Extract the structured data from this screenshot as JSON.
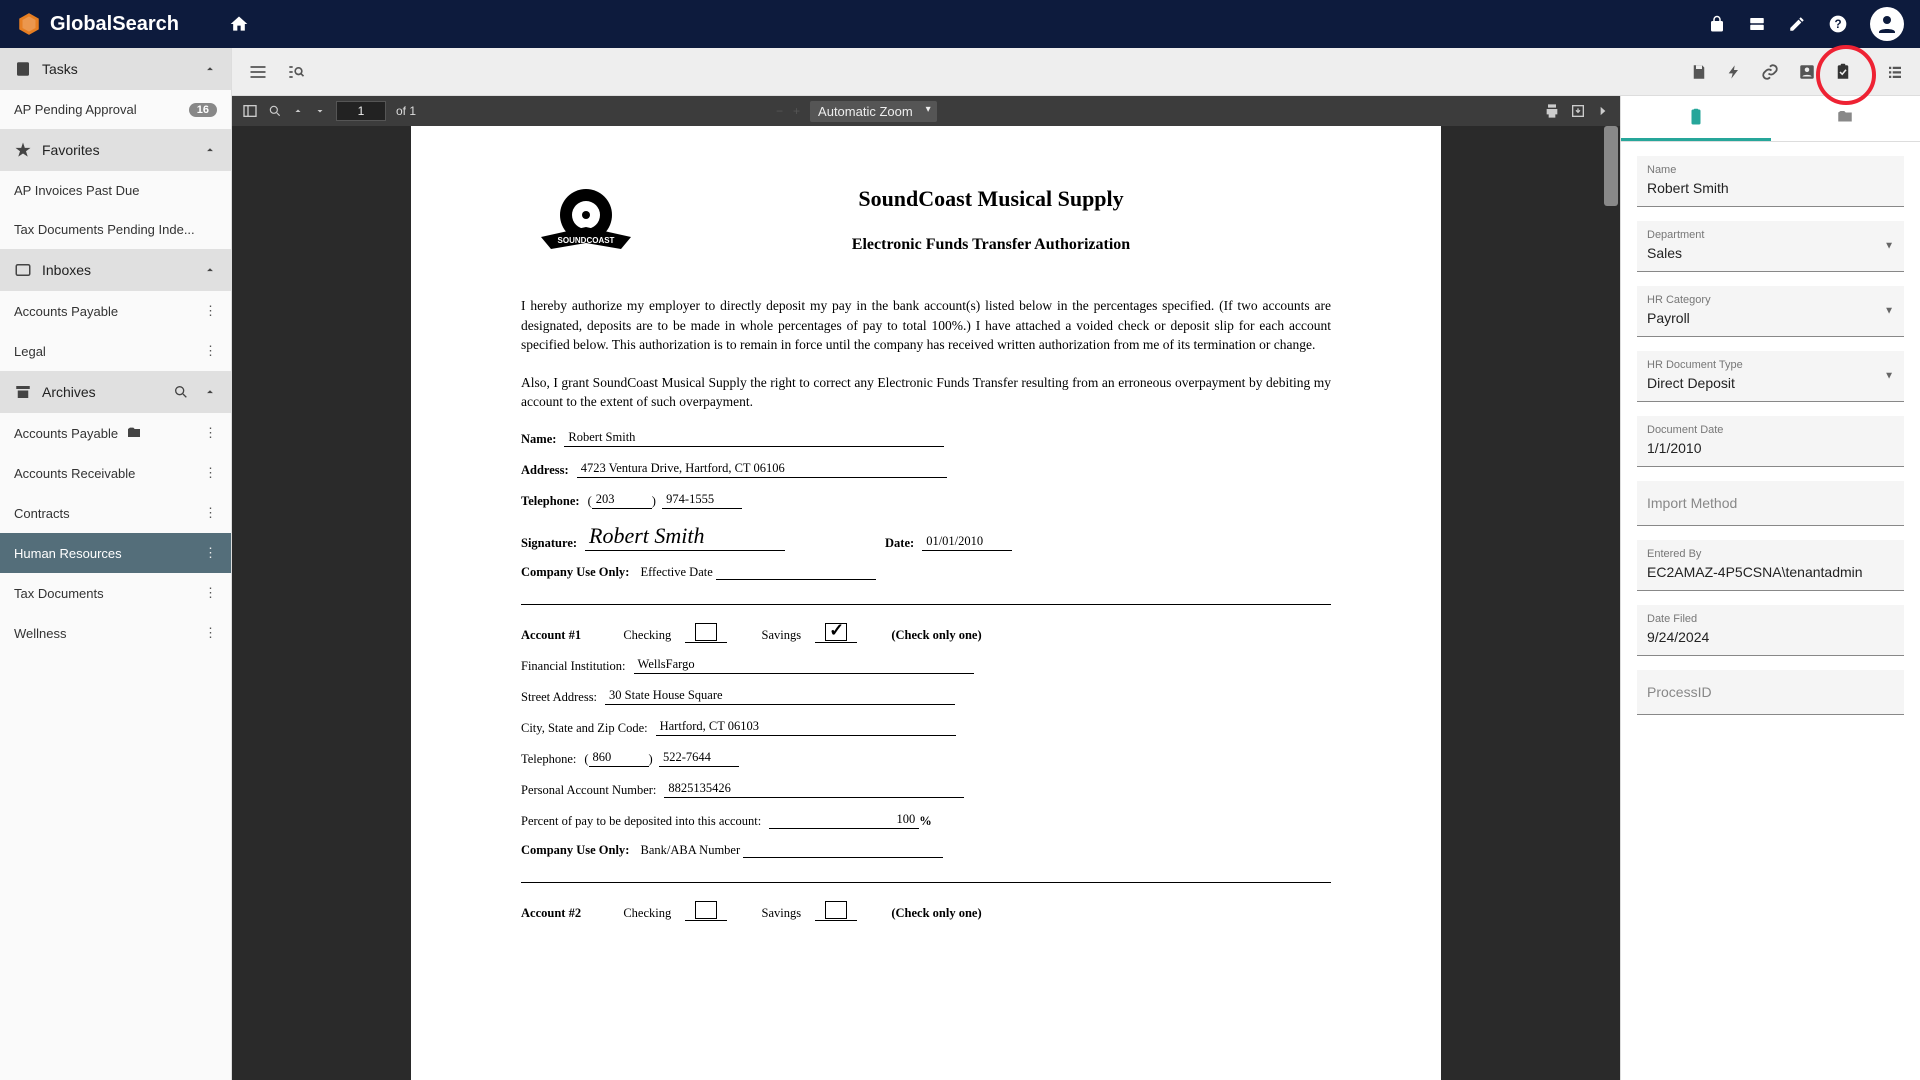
{
  "app": {
    "name": "GlobalSearch"
  },
  "sidebar": {
    "tasks": {
      "label": "Tasks",
      "items": [
        {
          "label": "AP Pending Approval",
          "badge": "16"
        }
      ]
    },
    "favorites": {
      "label": "Favorites",
      "items": [
        {
          "label": "AP Invoices Past Due"
        },
        {
          "label": "Tax Documents Pending Inde..."
        }
      ]
    },
    "inboxes": {
      "label": "Inboxes",
      "items": [
        {
          "label": "Accounts Payable"
        },
        {
          "label": "Legal"
        }
      ]
    },
    "archives": {
      "label": "Archives",
      "items": [
        {
          "label": "Accounts Payable",
          "folder": true
        },
        {
          "label": "Accounts Receivable"
        },
        {
          "label": "Contracts"
        },
        {
          "label": "Human Resources",
          "selected": true
        },
        {
          "label": "Tax Documents"
        },
        {
          "label": "Wellness"
        }
      ]
    }
  },
  "viewer": {
    "page_current": "1",
    "page_total": "of 1",
    "zoom": "Automatic Zoom"
  },
  "document": {
    "company": "SoundCoast Musical Supply",
    "title": "Electronic Funds Transfer Authorization",
    "para1": "I hereby authorize my employer to directly deposit my pay in the bank account(s) listed below in the percentages specified.  (If two accounts are designated, deposits are to be made in whole percentages of pay to total 100%.)  I have attached a voided check or deposit slip for each account specified below.  This authorization is to remain in force until the company has received written authorization from me of its termination or change.",
    "para2": "Also, I grant SoundCoast Musical Supply the right to correct any Electronic Funds Transfer resulting from an erroneous overpayment by debiting my account to the extent of such overpayment.",
    "name_label": "Name:",
    "name": "Robert Smith",
    "address_label": "Address:",
    "address": "4723 Ventura Drive, Hartford, CT 06106",
    "tel_label": "Telephone:",
    "tel_area": "203",
    "tel_num": "974-1555",
    "sig_label": "Signature:",
    "signature": "Robert Smith",
    "date_label": "Date:",
    "date": "01/01/2010",
    "company_use": "Company Use Only",
    "effective": "Effective Date",
    "acct1": "Account #1",
    "checking": "Checking",
    "savings": "Savings",
    "checkonly": "(Check only one)",
    "fin_inst_label": "Financial Institution:",
    "fin_inst": "WellsFargo",
    "street_label": "Street Address:",
    "street": "30 State House Square",
    "city_label": "City, State and Zip Code:",
    "city": "Hartford, CT 06103",
    "tel2_label": "Telephone:",
    "tel2_area": "860",
    "tel2_num": "522-7644",
    "pan_label": "Personal Account Number:",
    "pan": "8825135426",
    "pct_label": "Percent of pay to be deposited into this account:",
    "pct": "100",
    "pct_sym": "%",
    "bank_aba": "Bank/ABA Number",
    "acct2": "Account #2"
  },
  "props": {
    "fields": [
      {
        "label": "Name",
        "value": "Robert Smith",
        "dropdown": false
      },
      {
        "label": "Department",
        "value": "Sales",
        "dropdown": true
      },
      {
        "label": "HR Category",
        "value": "Payroll",
        "dropdown": true
      },
      {
        "label": "HR Document Type",
        "value": "Direct Deposit",
        "dropdown": true
      },
      {
        "label": "Document Date",
        "value": "1/1/2010",
        "dropdown": false
      },
      {
        "label": "Import Method",
        "value": "",
        "dropdown": false
      },
      {
        "label": "Entered By",
        "value": "EC2AMAZ-4P5CSNA\\tenantadmin",
        "dropdown": false
      },
      {
        "label": "Date Filed",
        "value": "9/24/2024",
        "dropdown": false
      },
      {
        "label": "ProcessID",
        "value": "",
        "dropdown": false
      }
    ]
  }
}
